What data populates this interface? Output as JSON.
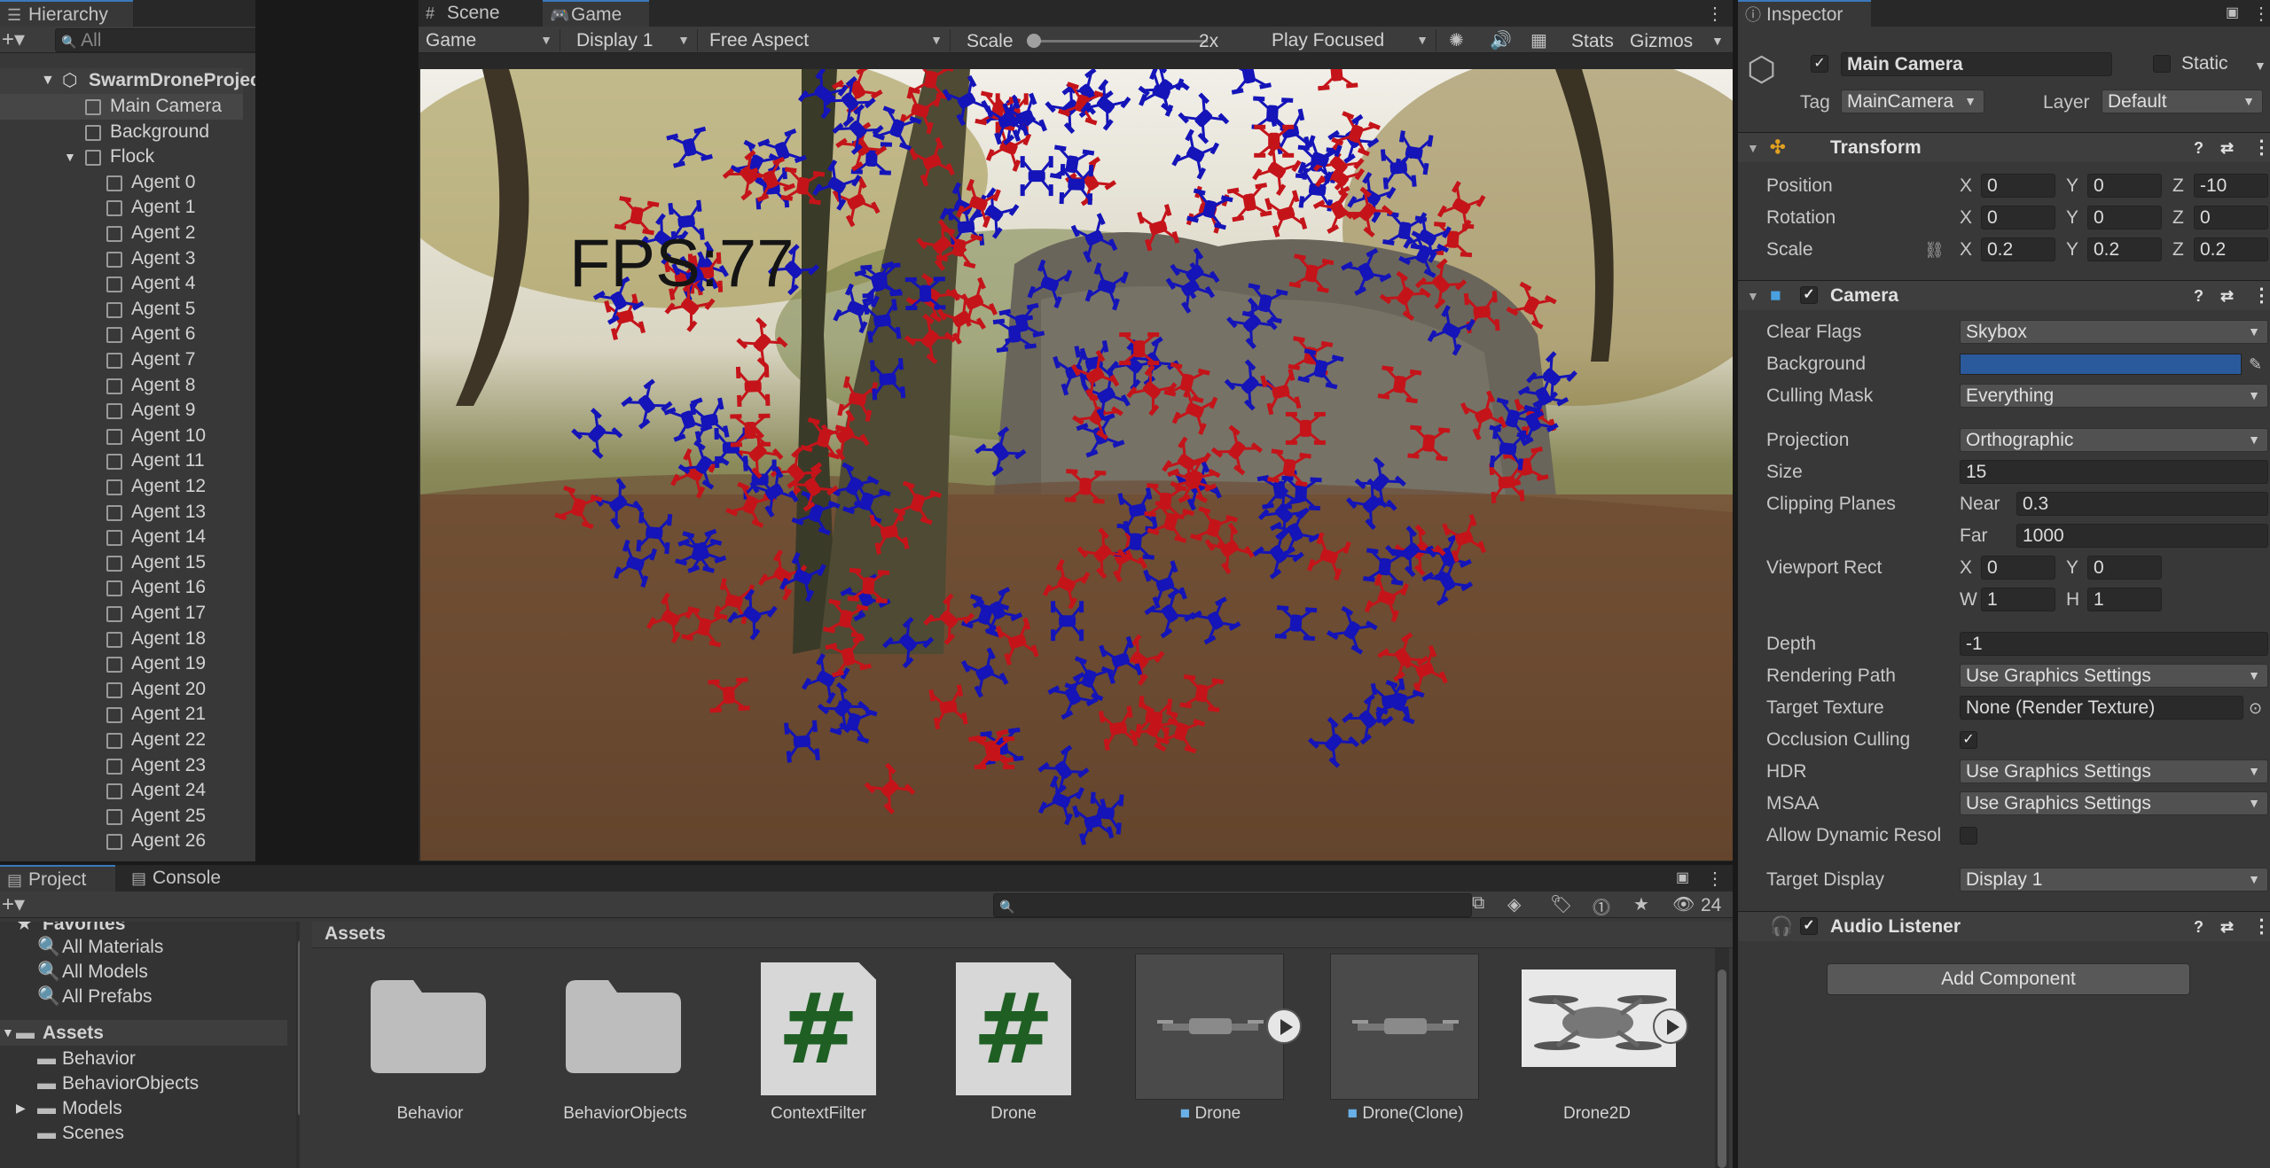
{
  "hierarchy": {
    "tab_label": "Hierarchy",
    "search_placeholder": "All",
    "root": "SwarmDroneProject*",
    "items": [
      {
        "label": "Main Camera"
      },
      {
        "label": "Background"
      },
      {
        "label": "Flock"
      },
      {
        "label": "Agent 0"
      },
      {
        "label": "Agent 1"
      },
      {
        "label": "Agent 2"
      },
      {
        "label": "Agent 3"
      },
      {
        "label": "Agent 4"
      },
      {
        "label": "Agent 5"
      },
      {
        "label": "Agent 6"
      },
      {
        "label": "Agent 7"
      },
      {
        "label": "Agent 8"
      },
      {
        "label": "Agent 9"
      },
      {
        "label": "Agent 10"
      },
      {
        "label": "Agent 11"
      },
      {
        "label": "Agent 12"
      },
      {
        "label": "Agent 13"
      },
      {
        "label": "Agent 14"
      },
      {
        "label": "Agent 15"
      },
      {
        "label": "Agent 16"
      },
      {
        "label": "Agent 17"
      },
      {
        "label": "Agent 18"
      },
      {
        "label": "Agent 19"
      },
      {
        "label": "Agent 20"
      },
      {
        "label": "Agent 21"
      },
      {
        "label": "Agent 22"
      },
      {
        "label": "Agent 23"
      },
      {
        "label": "Agent 24"
      },
      {
        "label": "Agent 25"
      },
      {
        "label": "Agent 26"
      }
    ]
  },
  "game": {
    "tab_scene": "Scene",
    "tab_game": "Game",
    "display_mode": "Game",
    "display": "Display 1",
    "aspect": "Free Aspect",
    "scale_label": "Scale",
    "scale_value": "2x",
    "play_mode": "Play Focused",
    "stats": "Stats",
    "gizmos": "Gizmos",
    "fps_text": "FPS:77",
    "drone_colors": {
      "red": "#c4141a",
      "blue": "#1414b8"
    }
  },
  "inspector": {
    "tab_label": "Inspector",
    "object_name": "Main Camera",
    "static_label": "Static",
    "tag_label": "Tag",
    "tag_value": "MainCamera",
    "layer_label": "Layer",
    "layer_value": "Default",
    "transform": {
      "title": "Transform",
      "position_label": "Position",
      "rotation_label": "Rotation",
      "scale_label": "Scale",
      "x": "X",
      "y": "Y",
      "z": "Z",
      "position": {
        "x": "0",
        "y": "0",
        "z": "-10"
      },
      "rotation": {
        "x": "0",
        "y": "0",
        "z": "0"
      },
      "scale": {
        "x": "0.2",
        "y": "0.2",
        "z": "0.2"
      }
    },
    "camera": {
      "title": "Camera",
      "clear_flags_label": "Clear Flags",
      "clear_flags": "Skybox",
      "background_label": "Background",
      "background_color": "#2b5a9c",
      "culling_mask_label": "Culling Mask",
      "culling_mask": "Everything",
      "projection_label": "Projection",
      "projection": "Orthographic",
      "size_label": "Size",
      "size": "15",
      "clipping_label": "Clipping Planes",
      "near_label": "Near",
      "near": "0.3",
      "far_label": "Far",
      "far": "1000",
      "viewport_label": "Viewport Rect",
      "w_label": "W",
      "h_label": "H",
      "vp_x": "0",
      "vp_y": "0",
      "vp_w": "1",
      "vp_h": "1",
      "depth_label": "Depth",
      "depth": "-1",
      "rendering_path_label": "Rendering Path",
      "rendering_path": "Use Graphics Settings",
      "target_texture_label": "Target Texture",
      "target_texture": "None (Render Texture)",
      "occlusion_label": "Occlusion Culling",
      "hdr_label": "HDR",
      "hdr": "Use Graphics Settings",
      "msaa_label": "MSAA",
      "msaa": "Use Graphics Settings",
      "dynamic_res_label": "Allow Dynamic Resol",
      "target_display_label": "Target Display",
      "target_display": "Display 1"
    },
    "audio_listener": {
      "title": "Audio Listener"
    },
    "add_component": "Add Component"
  },
  "project": {
    "tab_project": "Project",
    "tab_console": "Console",
    "favorites_label": "Favorites",
    "favorites": [
      "All Materials",
      "All Models",
      "All Prefabs"
    ],
    "assets_root": "Assets",
    "folders": [
      "Behavior",
      "BehaviorObjects",
      "Models",
      "Scenes"
    ],
    "breadcrumb": "Assets",
    "hidden_count": "24",
    "assets": [
      {
        "label": "Behavior",
        "kind": "folder"
      },
      {
        "label": "BehaviorObjects",
        "kind": "folder"
      },
      {
        "label": "ContextFilter",
        "kind": "script"
      },
      {
        "label": "Drone",
        "kind": "script"
      },
      {
        "label": "Drone",
        "kind": "prefab"
      },
      {
        "label": "Drone(Clone)",
        "kind": "prefab"
      },
      {
        "label": "Drone2D",
        "kind": "model"
      }
    ]
  }
}
